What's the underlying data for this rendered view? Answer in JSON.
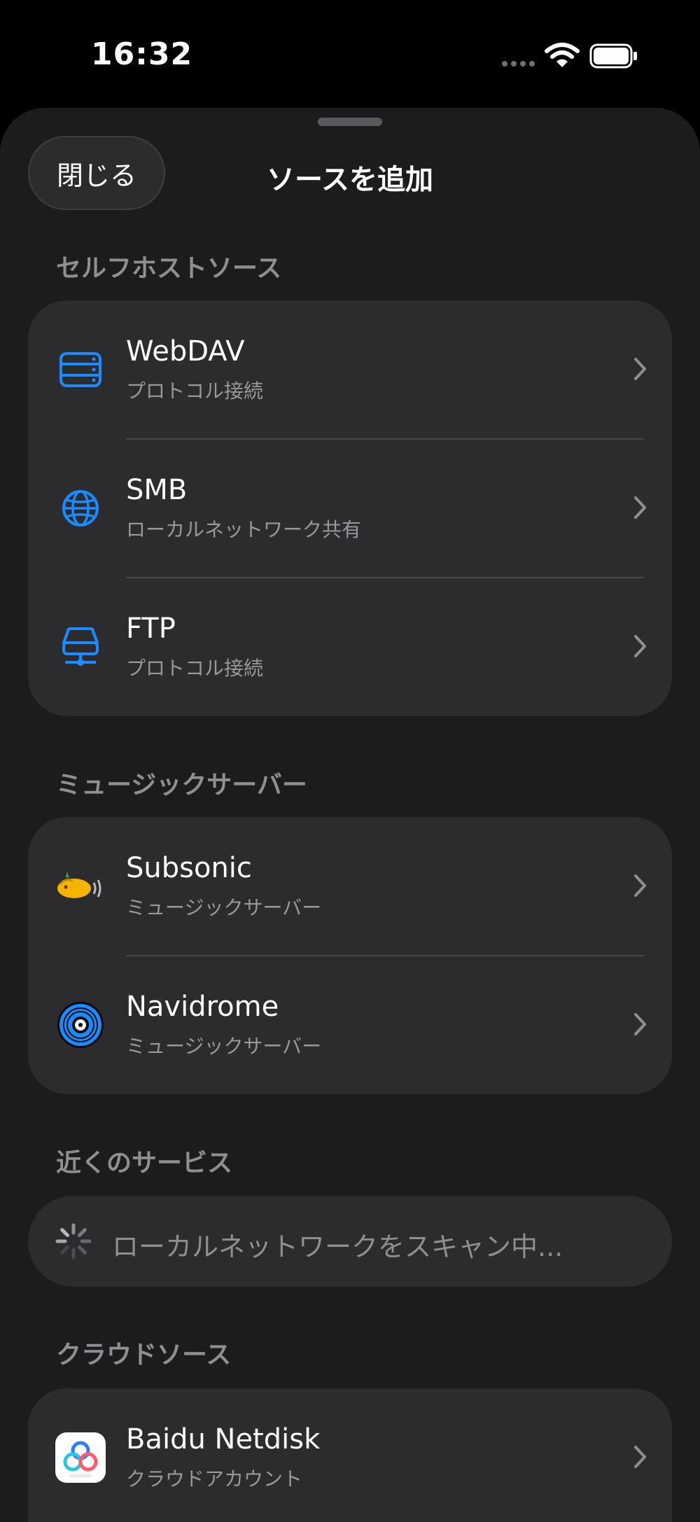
{
  "status": {
    "time": "16:32"
  },
  "header": {
    "close_label": "閉じる",
    "title": "ソースを追加"
  },
  "sections": {
    "self_hosted": {
      "title": "セルフホストソース",
      "items": [
        {
          "title": "WebDAV",
          "subtitle": "プロトコル接続",
          "icon": "server-rack-icon"
        },
        {
          "title": "SMB",
          "subtitle": "ローカルネットワーク共有",
          "icon": "globe-icon"
        },
        {
          "title": "FTP",
          "subtitle": "プロトコル接続",
          "icon": "network-drive-icon"
        }
      ]
    },
    "music_servers": {
      "title": "ミュージックサーバー",
      "items": [
        {
          "title": "Subsonic",
          "subtitle": "ミュージックサーバー",
          "icon": "subsonic-logo-icon"
        },
        {
          "title": "Navidrome",
          "subtitle": "ミュージックサーバー",
          "icon": "navidrome-logo-icon"
        }
      ]
    },
    "nearby": {
      "title": "近くのサービス",
      "scan_text": "ローカルネットワークをスキャン中..."
    },
    "cloud": {
      "title": "クラウドソース",
      "items": [
        {
          "title": "Baidu Netdisk",
          "subtitle": "クラウドアカウント",
          "icon": "baidu-netdisk-logo-icon"
        }
      ]
    }
  },
  "colors": {
    "accent": "#1a8cff",
    "sheet": "#1c1c1e",
    "card": "#2c2c2e",
    "secondary_text": "#98989d"
  }
}
